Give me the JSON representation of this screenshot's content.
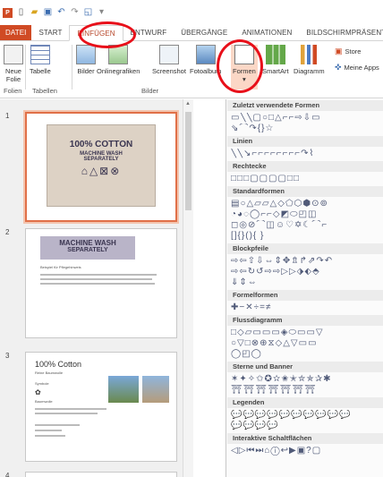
{
  "menu": {
    "file": "DATEI",
    "tabs": [
      "START",
      "EINFÜGEN",
      "ENTWURF",
      "ÜBERGÄNGE",
      "ANIMATIONEN",
      "BILDSCHIRMPRÄSENTATION"
    ]
  },
  "ribbon": {
    "neue_folie": "Neue",
    "neue_folie_2": "Folie",
    "tabelle": "Tabelle",
    "bilder": "Bilder",
    "onlinegrafiken": "Onlinegrafiken",
    "screenshot": "Screenshot",
    "fotoalbum": "Fotoalbum",
    "formen": "Formen",
    "smartart": "SmartArt",
    "diagramm": "Diagramm",
    "store": "Store",
    "meine_apps": "Meine Apps",
    "group_folien": "Folien",
    "group_tabellen": "Tabellen",
    "group_bilder": "Bilder"
  },
  "slides": [
    {
      "number": "1",
      "title": "100% COTTON",
      "line1": "MACHINE WASH",
      "line2": "SEPARATELY"
    },
    {
      "number": "2",
      "title": "MACHINE WASH",
      "title2": "SEPARATELY",
      "text": "Beispiel für Pflegehinweis"
    },
    {
      "number": "3",
      "title": "100% Cotton",
      "text": "Reine Baumwolle",
      "label1": "Symbole",
      "label2": "Baumwolle"
    },
    {
      "number": "4"
    }
  ],
  "shapes_panel": {
    "sections": [
      {
        "title": "Zuletzt verwendete Formen",
        "rows": [
          "▭╲╲▢○□△⌐⌐⇨⇩▭",
          "⇘⌒↷{}☆"
        ]
      },
      {
        "title": "Linien",
        "rows": [
          "╲╲↘⌐⌐⌐⌐⌐⌐⌐⌐↷⌇"
        ]
      },
      {
        "title": "Rechtecke",
        "rows": [
          "□□□▢▢▢▢□□"
        ]
      },
      {
        "title": "Standardformen",
        "rows": [
          "▤○△▱▱△◇⬠⬡⬢⊙⊚",
          "◔◕◌◯⌐⌐◇◩⬭◰◫",
          "◻◎⊘⌒◫☺♡✡☾⌒⌐",
          "[]{}(){ }"
        ]
      },
      {
        "title": "Blockpfeile",
        "rows": [
          "⇨⇦⇧⇩⇔⇕✥⇯↱⇗↷↶",
          "⇨⇦↻↺⇨⇨▷▷⬗⬖⬘",
          "⇓⇕⇔"
        ]
      },
      {
        "title": "Formelformen",
        "rows": [
          "✚−✕÷=≠"
        ]
      },
      {
        "title": "Flussdiagramm",
        "rows": [
          "□◇▱▭▭▭◈⬭▭▭▽",
          "○▽□⊗⊕⧖◇△▽▭▭",
          "◯◰◯"
        ]
      },
      {
        "title": "Sterne und Banner",
        "rows": [
          "✶✦✧✩✪✫✬✭✮✯✰✱",
          "⛩⛩⛩⛩⛩⛩⛩"
        ]
      },
      {
        "title": "Legenden",
        "rows": [
          "💬💬💬💬💬💬💬💬💬💬",
          "💬💬💬💬"
        ]
      },
      {
        "title": "Interaktive Schaltflächen",
        "rows": [
          "◁▷⏮⏭⌂ⓘ↩▶▣?▢"
        ]
      }
    ]
  }
}
